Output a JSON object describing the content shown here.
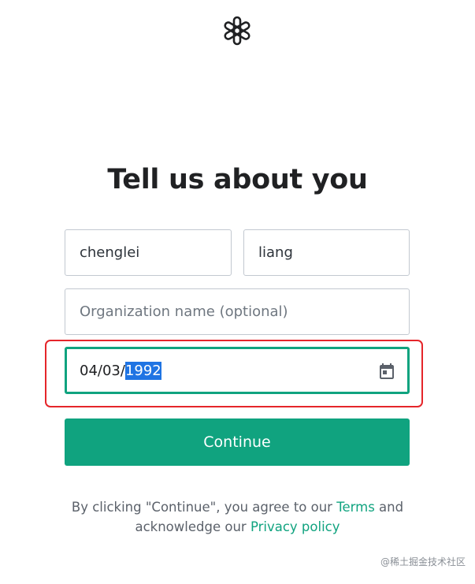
{
  "heading": "Tell us about you",
  "form": {
    "first_name": "chenglei",
    "last_name": "liang",
    "organization_placeholder": "Organization name (optional)",
    "birthdate_prefix": "04/03/",
    "birthdate_selected": "1992",
    "calendar_icon": "calendar-icon"
  },
  "continue_label": "Continue",
  "legal": {
    "text_1": "By clicking \"Continue\", you agree to our ",
    "terms_link": "Terms",
    "text_2": " and",
    "text_3": "acknowledge our ",
    "privacy_link": "Privacy policy"
  },
  "watermark": "@稀土掘金技术社区",
  "colors": {
    "accent": "#10a37f",
    "highlight_frame": "#e5252a",
    "selection": "#1f74e3",
    "text": "#202123"
  },
  "logo_icon": "openai-logo-icon"
}
